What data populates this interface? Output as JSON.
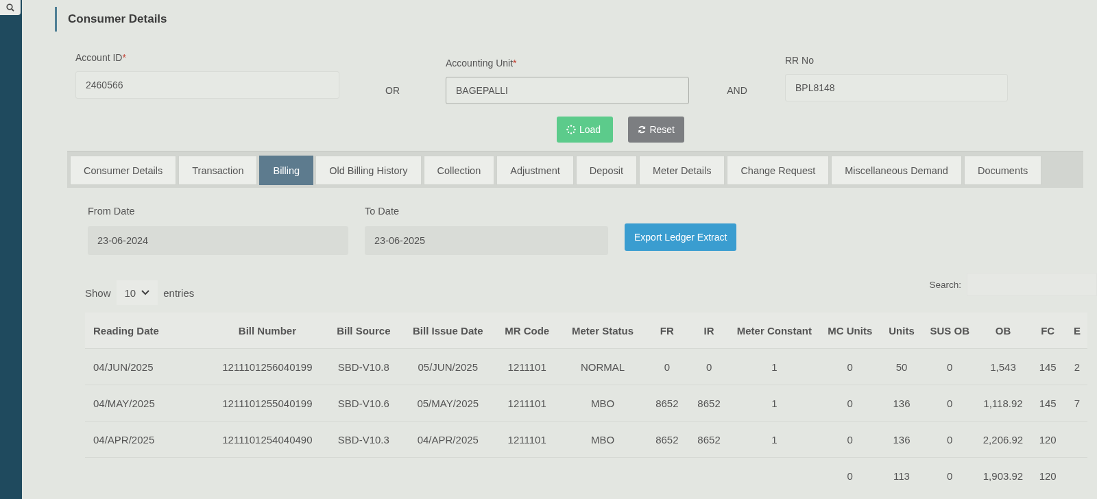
{
  "title": "Consumer Details",
  "form": {
    "fields": [
      {
        "label": "Account ID",
        "marker": "*",
        "value": "2460566"
      },
      {
        "label": "Accounting Unit",
        "marker": "*",
        "value": "BAGEPALLI"
      },
      {
        "label": "RR No",
        "value": "BPL8148"
      }
    ],
    "joiners": [
      "OR",
      "AND"
    ]
  },
  "buttons": [
    {
      "label": "Load",
      "kind": "load"
    },
    {
      "label": "Reset",
      "kind": "reset"
    }
  ],
  "tabs": [
    {
      "label": "Consumer Details",
      "selected": false
    },
    {
      "label": "Transaction",
      "selected": false
    },
    {
      "label": "Billing",
      "selected": true
    },
    {
      "label": "Old Billing History",
      "selected": false
    },
    {
      "label": "Collection",
      "selected": false
    },
    {
      "label": "Adjustment",
      "selected": false
    },
    {
      "label": "Deposit",
      "selected": false
    },
    {
      "label": "Meter Details",
      "selected": false
    },
    {
      "label": "Change Request",
      "selected": false
    },
    {
      "label": "Miscellaneous Demand",
      "selected": false
    },
    {
      "label": "Documents",
      "selected": false
    }
  ],
  "date_filter": {
    "from": {
      "label": "From Date",
      "value": "23-06-2024"
    },
    "to": {
      "label": "To Date",
      "value": "23-06-2025"
    },
    "export_button": "Export Ledger Extract"
  },
  "table": {
    "show_label": "Show",
    "page_size": "10",
    "entries_label": "entries",
    "search_label": "Search:",
    "columns": [
      "Reading Date",
      "Bill Number",
      "Bill Source",
      "Bill Issue Date",
      "MR Code",
      "Meter Status",
      "FR",
      "IR",
      "Meter Constant",
      "MC Units",
      "Units",
      "SUS OB",
      "OB",
      "FC",
      "E"
    ],
    "rows": [
      [
        "04/JUN/2025",
        "1211101256040199",
        "SBD-V10.8",
        "05/JUN/2025",
        "1211101",
        "NORMAL",
        "0",
        "0",
        "1",
        "0",
        "50",
        "0",
        "1,543",
        "145",
        "2"
      ],
      [
        "04/MAY/2025",
        "1211101255040199",
        "SBD-V10.6",
        "05/MAY/2025",
        "1211101",
        "MBO",
        "8652",
        "8652",
        "1",
        "0",
        "136",
        "0",
        "1,118.92",
        "145",
        "7"
      ],
      [
        "04/APR/2025",
        "1211101254040490",
        "SBD-V10.3",
        "04/APR/2025",
        "1211101",
        "MBO",
        "8652",
        "8652",
        "1",
        "0",
        "136",
        "0",
        "2,206.92",
        "120",
        null
      ],
      [
        null,
        null,
        null,
        null,
        null,
        null,
        null,
        null,
        null,
        "0",
        "113",
        "0",
        "1,903.92",
        "120",
        null
      ]
    ]
  }
}
